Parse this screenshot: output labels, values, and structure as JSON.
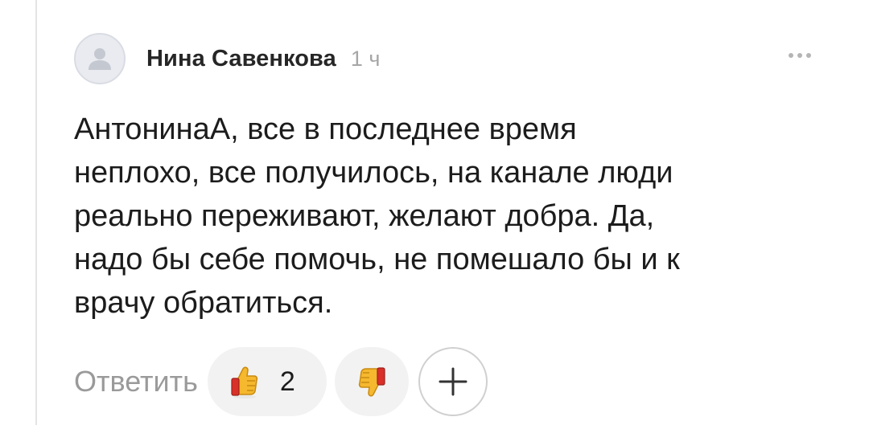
{
  "comment": {
    "author": "Нина Савенкова",
    "time": "1 ч",
    "text": "АнтонинаА, все в последнее время\nнеплохо, все получилось, на канале люди\nреально переживают, желают добра. Да,\nнадо бы себе помочь, не помешало бы и к\nврачу обратиться.",
    "avatar_icon": "user-placeholder-icon",
    "more_icon": "more-dots-icon"
  },
  "actions": {
    "reply_label": "Ответить",
    "like_icon": "thumbs-up-emoji-icon",
    "like_count": "2",
    "dislike_icon": "thumbs-down-emoji-icon",
    "add_reaction_icon": "plus-icon"
  },
  "colors": {
    "author": "#262626",
    "muted": "#a6a6a6",
    "pill_bg": "#f2f2f2",
    "emoji_yellow": "#f5b82e",
    "emoji_red": "#d9302a"
  }
}
